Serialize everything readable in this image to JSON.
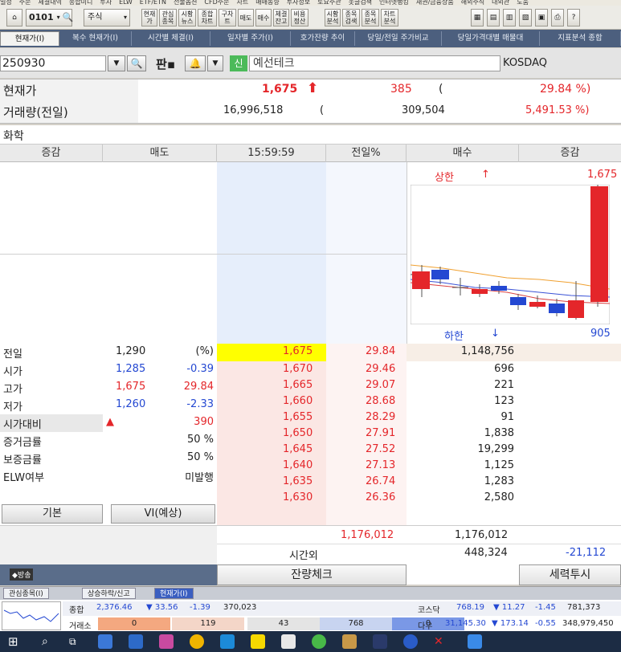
{
  "menu": [
    "일정",
    "주문",
    "체결내역",
    "종합미니",
    "투자",
    "ELW",
    "ETF/ETN",
    "선물옵션",
    "CFD주문",
    "차트",
    "매매동향",
    "투자정보",
    "토요주관",
    "옷글검색",
    "인터넷뱅킹",
    "채권/금융상품",
    "해외주식",
    "대외관",
    "도움"
  ],
  "toolbar": {
    "screen_no": "0101",
    "type_select": "주식",
    "buttons": [
      "현재가",
      "관심종목",
      "시황뉴스",
      "종합차트",
      "구차트",
      "매도",
      "매수",
      "체결잔고",
      "비용정산",
      "시황분석",
      "종목검색",
      "종목분석",
      "차트분석"
    ]
  },
  "tabs": [
    "현재가(I)",
    "복수 현재가(I)",
    "시간별 체결(I)",
    "일자별 주가(I)",
    "호가잔량 추이",
    "당일/전일 주가비교",
    "당일가격대별 매물대",
    "지표분석 종합"
  ],
  "stock": {
    "code": "250930",
    "badge": "신",
    "name": "예선테크",
    "market": "KOSDAQ",
    "price_label": "현재가",
    "price": "1,675",
    "change": "385",
    "change_paren": "(",
    "change_rate": "29.84 %)",
    "volume_label": "거래량(전일)",
    "volume": "16,996,518",
    "volume_paren": "(",
    "prev_volume": "309,504",
    "volume_rate": "5,491.53 %)",
    "sector": "화학"
  },
  "orderbook": {
    "headers": [
      "증감",
      "매도",
      "15:59:59",
      "전일%",
      "매수",
      "증감"
    ],
    "chart_upper_label": "상한",
    "chart_upper_arrow": "↑",
    "chart_upper_value": "1,675",
    "chart_lower_label": "하한",
    "chart_lower_arrow": "↓",
    "chart_lower_value": "905",
    "bid_rows": [
      {
        "price": "1,675",
        "pct": "29.84",
        "qty": "1,148,756"
      },
      {
        "price": "1,670",
        "pct": "29.46",
        "qty": "696"
      },
      {
        "price": "1,665",
        "pct": "29.07",
        "qty": "221"
      },
      {
        "price": "1,660",
        "pct": "28.68",
        "qty": "123"
      },
      {
        "price": "1,655",
        "pct": "28.29",
        "qty": "91"
      },
      {
        "price": "1,650",
        "pct": "27.91",
        "qty": "1,838"
      },
      {
        "price": "1,645",
        "pct": "27.52",
        "qty": "19,299"
      },
      {
        "price": "1,640",
        "pct": "27.13",
        "qty": "1,125"
      },
      {
        "price": "1,635",
        "pct": "26.74",
        "qty": "1,283"
      },
      {
        "price": "1,630",
        "pct": "26.36",
        "qty": "2,580"
      }
    ],
    "info_rows": [
      {
        "label": "전일",
        "value": "1,290",
        "extra": "(%)"
      },
      {
        "label": "시가",
        "value": "1,285",
        "extra": "-0.39"
      },
      {
        "label": "고가",
        "value": "1,675",
        "extra": "29.84"
      },
      {
        "label": "저가",
        "value": "1,260",
        "extra": "-2.33"
      },
      {
        "label": "시가대비",
        "value": "▲",
        "extra": "390"
      },
      {
        "label": "증거금률",
        "value": "",
        "extra": "50 %"
      },
      {
        "label": "보증금률",
        "value": "",
        "extra": "50 %"
      },
      {
        "label": "ELW여부",
        "value": "",
        "extra": "미발행"
      }
    ],
    "btn_basic": "기본",
    "btn_vi": "VI(예상)",
    "total_ask": "1,176,012",
    "total_bid": "1,176,012",
    "after_label": "시간외",
    "after_qty": "448,324",
    "after_change": "-21,112",
    "btn_check": "잔량체크",
    "btn_force": "세력투시"
  },
  "bottom_tabs": [
    "관심종목(I)",
    "상승하락/신고",
    "현재가(I)"
  ],
  "ticker": {
    "row1_label": "종합",
    "kospi": "2,376.46",
    "kospi_chg": "▼ 33.56",
    "kospi_rate": "-1.39",
    "kospi_vol": "370,023",
    "kosdaq_label": "코스닥",
    "kosdaq": "768.19",
    "kosdaq_chg": "▼ 11.27",
    "kosdaq_rate": "-1.45",
    "kosdaq_vol": "781,373",
    "row2_label": "거래소",
    "ex_vals": [
      "0",
      "119",
      "43",
      "768",
      "0"
    ],
    "dow_label": "다우",
    "dow": "31,145.30",
    "dow_chg": "▼ 173.14",
    "dow_rate": "-0.55",
    "dow_vol": "348,979,450"
  },
  "colors": {
    "up": "#e4262a",
    "down": "#2448d2",
    "highlight": "#ffff00",
    "bid_bg": "#fbe7e4",
    "ask_bg": "#e6eefb"
  }
}
